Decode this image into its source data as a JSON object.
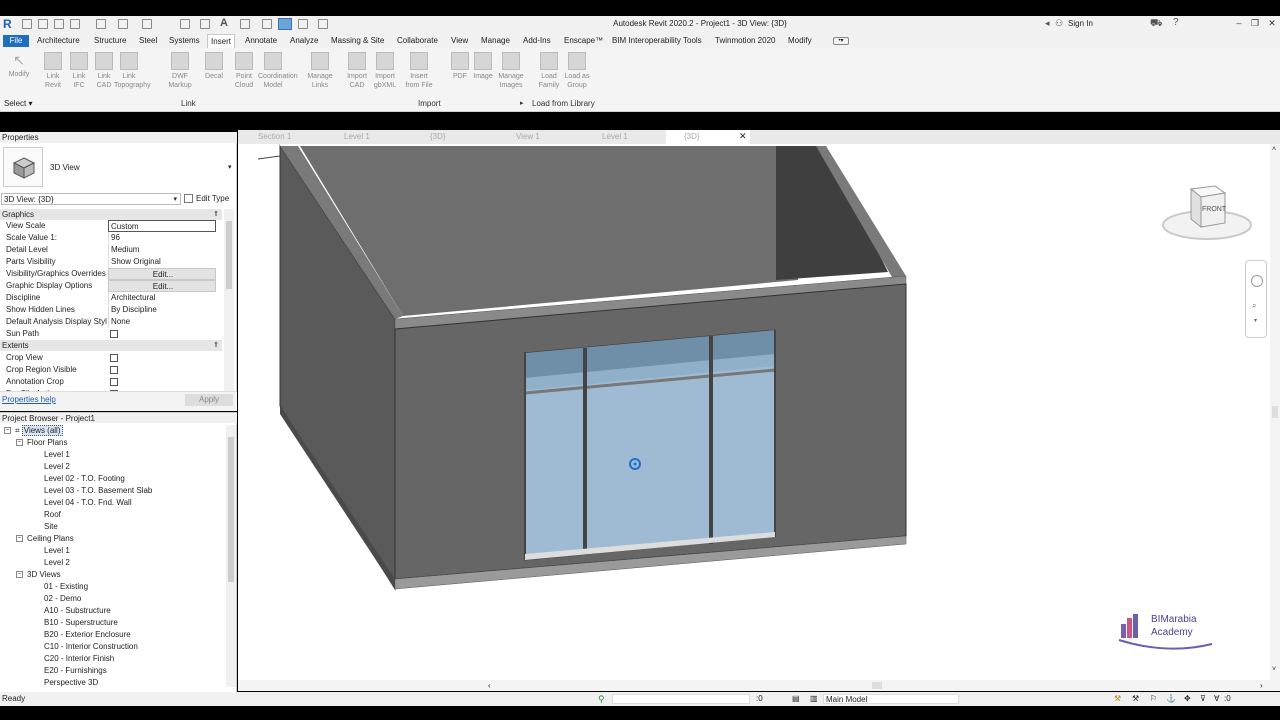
{
  "titlebar": {
    "title": "Autodesk Revit 2020.2 - Project1 - 3D View: {3D}",
    "signin": "Sign In"
  },
  "menubar": {
    "items": [
      "File",
      "Architecture",
      "Structure",
      "Steel",
      "Systems",
      "Insert",
      "Annotate",
      "Analyze",
      "Massing & Site",
      "Collaborate",
      "View",
      "Manage",
      "Add-Ins",
      "Enscape™",
      "BIM Interoperability Tools",
      "Twinmotion 2020",
      "Modify"
    ]
  },
  "ribbon": {
    "modify": "Modify",
    "select": "Select",
    "buttons": [
      {
        "l1": "Link",
        "l2": "Revit"
      },
      {
        "l1": "Link",
        "l2": "IFC"
      },
      {
        "l1": "Link",
        "l2": "CAD"
      },
      {
        "l1": "Link",
        "l2": "Topography"
      },
      {
        "l1": "DWF",
        "l2": "Markup"
      },
      {
        "l1": "Decal",
        "l2": ""
      },
      {
        "l1": "Point",
        "l2": "Cloud"
      },
      {
        "l1": "Coordination",
        "l2": "Model"
      },
      {
        "l1": "Manage",
        "l2": "Links"
      },
      {
        "l1": "Import",
        "l2": "CAD"
      },
      {
        "l1": "Import",
        "l2": "gbXML"
      },
      {
        "l1": "Insert",
        "l2": "from File"
      },
      {
        "l1": "PDF",
        "l2": ""
      },
      {
        "l1": "Image",
        "l2": ""
      },
      {
        "l1": "Manage",
        "l2": "Images"
      },
      {
        "l1": "Load",
        "l2": "Family"
      },
      {
        "l1": "Load as",
        "l2": "Group"
      }
    ],
    "groups": {
      "link": "Link",
      "import": "Import",
      "load": "Load from Library"
    }
  },
  "properties": {
    "title": "Properties",
    "type_name": "3D View",
    "type_select": "3D View: {3D}",
    "edit_type": "Edit Type",
    "graphics_header": "Graphics",
    "rows": [
      {
        "k": "View Scale",
        "v": "Custom"
      },
      {
        "k": "Scale Value    1:",
        "v": "96"
      },
      {
        "k": "Detail Level",
        "v": "Medium"
      },
      {
        "k": "Parts Visibility",
        "v": "Show Original"
      },
      {
        "k": "Visibility/Graphics Overrides",
        "v": "Edit..."
      },
      {
        "k": "Graphic Display Options",
        "v": "Edit..."
      },
      {
        "k": "Discipline",
        "v": "Architectural"
      },
      {
        "k": "Show Hidden Lines",
        "v": "By Discipline"
      },
      {
        "k": "Default Analysis Display Style",
        "v": "None"
      },
      {
        "k": "Sun Path",
        "v": ""
      }
    ],
    "extents_header": "Extents",
    "extents_rows": [
      {
        "k": "Crop View"
      },
      {
        "k": "Crop Region Visible"
      },
      {
        "k": "Annotation Crop"
      },
      {
        "k": "Far Clip Active"
      }
    ],
    "help": "Properties help",
    "apply": "Apply"
  },
  "project_browser": {
    "title": "Project Browser - Project1",
    "root": "Views (all)",
    "floor_plans": "Floor Plans",
    "floor_items": [
      "Level 1",
      "Level 2",
      "Level 02 - T.O. Footing",
      "Level 03 - T.O. Basement Slab",
      "Level 04 - T.O. Fnd. Wall",
      "Roof",
      "Site"
    ],
    "ceiling_plans": "Ceiling Plans",
    "ceiling_items": [
      "Level 1",
      "Level 2"
    ],
    "views_3d": "3D Views",
    "views_3d_items": [
      "01 - Existing",
      "02 - Demo",
      "A10 - Substructure",
      "B10 - Superstructure",
      "B20 - Exterior Enclosure",
      "C10 - Interior Construction",
      "C20 - Interior Finish",
      "E20 - Furnishings",
      "Perspective 3D"
    ]
  },
  "tabs": [
    "Section 1",
    "Level 1",
    "{3D}",
    "View 1",
    "Level 1",
    "{3D}"
  ],
  "viewcube": {
    "face": "FRONT"
  },
  "watermark": {
    "l1": "BIMarabia",
    "l2": "Academy"
  },
  "status": {
    "left": "Ready",
    "zero1": ":0",
    "model": "Main Model",
    "zero2": ":0"
  }
}
